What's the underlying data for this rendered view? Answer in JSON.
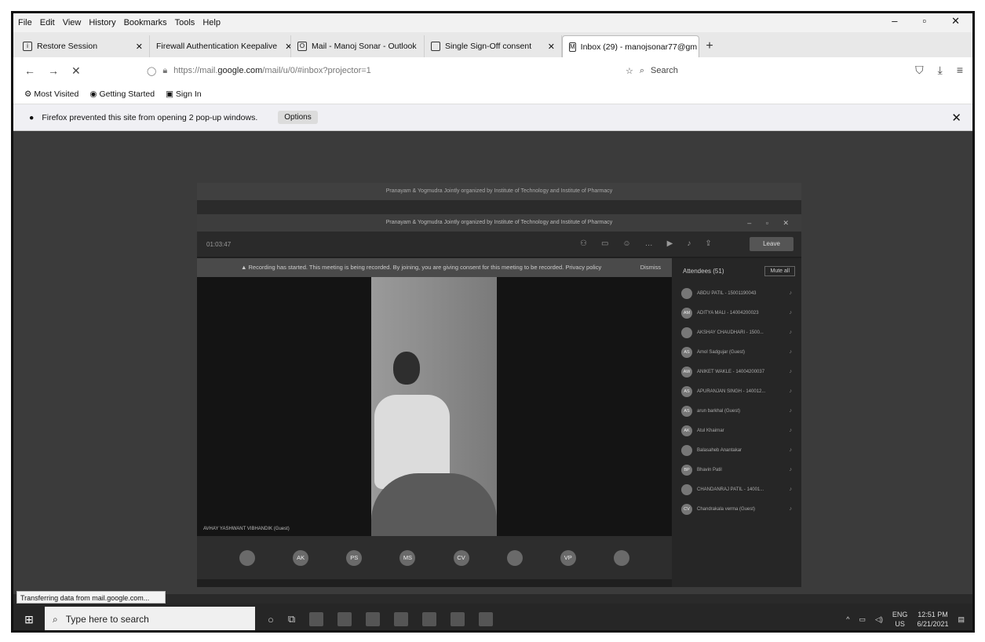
{
  "menu": [
    "File",
    "Edit",
    "View",
    "History",
    "Bookmarks",
    "Tools",
    "Help"
  ],
  "window_controls": [
    "–",
    "▫",
    "✕"
  ],
  "tabs": [
    {
      "label": "Restore Session",
      "icon": "info-icon"
    },
    {
      "label": "Firewall Authentication Keepalive",
      "icon": ""
    },
    {
      "label": "Mail - Manoj Sonar - Outlook",
      "icon": "outlook-icon"
    },
    {
      "label": "Single Sign-Off consent",
      "icon": "page-icon"
    },
    {
      "label": "Inbox (29) - manojsonar77@gm",
      "icon": "gmail-icon"
    }
  ],
  "nav": {
    "url_prefix": "https://mail.",
    "url_domain": "google.com",
    "url_rest": "/mail/u/0/#inbox?projector=1",
    "search_placeholder": "Search"
  },
  "bookmarks": [
    "Most Visited",
    "Getting Started",
    "Sign In"
  ],
  "notification": {
    "message": "Firefox prevented this site from opening 2 pop-up windows.",
    "options": "Options"
  },
  "teams": {
    "title": "Pranayam & Yogmudra Jointly organized by Institute of Technology and Institute of Pharmacy",
    "title_back": "Pranayam & Yogmudra Jointly organized by Institute of Technology and Institute of Pharmacy",
    "timer": "01:03:47",
    "leave": "Leave",
    "recording": "Recording has started. This meeting is being recorded. By joining, you are giving consent for this meeting to be recorded. Privacy policy",
    "dismiss": "Dismiss",
    "stage_label": "AVHAY YASHWANT VIBHANDIK (Guest)",
    "attendees_label": "Attendees (51)",
    "mute_all": "Mute all",
    "avatars": [
      "",
      "AK",
      "PS",
      "MS",
      "CV",
      "",
      "VP",
      ""
    ],
    "roster": [
      {
        "initials": "",
        "name": "ABDU PATIL - 15001190043"
      },
      {
        "initials": "AM",
        "name": "ADITYA MALI - 14004200023"
      },
      {
        "initials": "",
        "name": "AKSHAY CHAUDHARI - 1500..."
      },
      {
        "initials": "AS",
        "name": "Amol Sadgujar (Guest)"
      },
      {
        "initials": "AW",
        "name": "ANIKET WAKLE - 14004200037"
      },
      {
        "initials": "AS",
        "name": "APURANJAN SINGH - 140012..."
      },
      {
        "initials": "AS",
        "name": "arun barkhal (Guest)"
      },
      {
        "initials": "AK",
        "name": "Atul Khairnar"
      },
      {
        "initials": "",
        "name": "Balasaheb Anantakar"
      },
      {
        "initials": "BP",
        "name": "Bhavin Patil"
      },
      {
        "initials": "",
        "name": "CHANDANRAJ PATIL - 14001..."
      },
      {
        "initials": "CV",
        "name": "Chandrakala verma (Guest)"
      }
    ]
  },
  "statusbar": "Transferring data from mail.google.com...",
  "taskbar": {
    "search_placeholder": "Type here to search",
    "lang": "ENG",
    "region": "US",
    "time": "12:51 PM",
    "date": "6/21/2021"
  }
}
